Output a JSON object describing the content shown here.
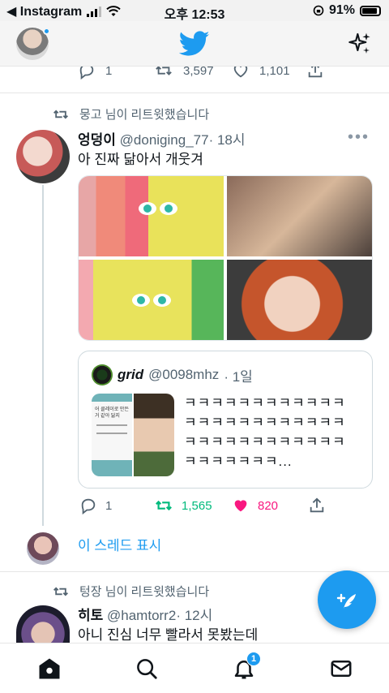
{
  "status_bar": {
    "back_app": "◀ Instagram",
    "time": "오후 12:53",
    "battery": "91%"
  },
  "previous_tweet": {
    "reply_count": "1",
    "retweet_count": "3,597",
    "like_count": "1,101"
  },
  "tweet1": {
    "retweeted_by": "뭉고 님이 리트윗했습니다",
    "name": "엉덩이",
    "handle": "@doniging_77",
    "time": "· 18시",
    "text": "아 진짜 닮아서 개웃겨",
    "more": "•••",
    "quote": {
      "name": "grid",
      "handle": "@0098mhz",
      "time": "· 1일",
      "text": "ㅋㅋㅋㅋㅋㅋㅋㅋㅋㅋㅋㅋㅋㅋㅋㅋㅋㅋㅋㅋㅋㅋㅋㅋㅋㅋㅋㅋㅋㅋㅋㅋㅋㅋㅋㅋㅋㅋㅋㅋㅋㅋㅋ...",
      "thumb_caption": "어 클레이로 만든거 같아 닮지"
    },
    "reply_count": "1",
    "retweet_count": "1,565",
    "like_count": "820",
    "show_thread": "이 스레드 표시"
  },
  "tweet2": {
    "retweeted_by": "텅장 님이 리트윗했습니다",
    "name": "히토",
    "handle": "@hamtorr2",
    "time": "· 12시",
    "text": "아니 진심 너무 빨라서 못봤는데"
  },
  "bottom_nav": {
    "notification_badge": "1"
  },
  "colors": {
    "twitter_blue": "#1d9bf0",
    "retweet_green": "#00ba7c",
    "like_pink": "#f91880",
    "muted": "#536471"
  }
}
